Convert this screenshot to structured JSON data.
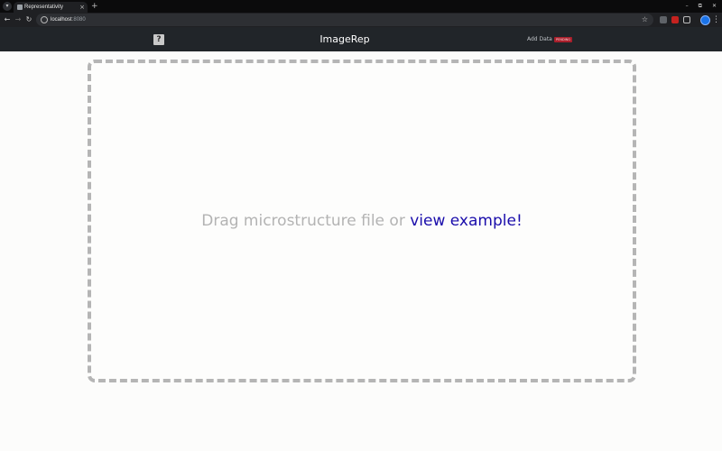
{
  "browser": {
    "tab_title": "Representativity",
    "tab_close": "×",
    "new_tab": "+",
    "url_host": "localhost",
    "url_port": ":8080",
    "window_controls": [
      "–",
      "⧉",
      "✕"
    ]
  },
  "navbar": {
    "brand": "ImageRep",
    "add_data_label": "Add Data",
    "badge_label": "PENDING"
  },
  "dropzone": {
    "prompt": "Drag microstructure file or ",
    "link_text": "view example!"
  },
  "colors": {
    "navbar_bg": "#212529",
    "link_blue": "#1a0dab",
    "badge_red": "#a81f2b",
    "dashed_border": "#b5b5b5"
  }
}
